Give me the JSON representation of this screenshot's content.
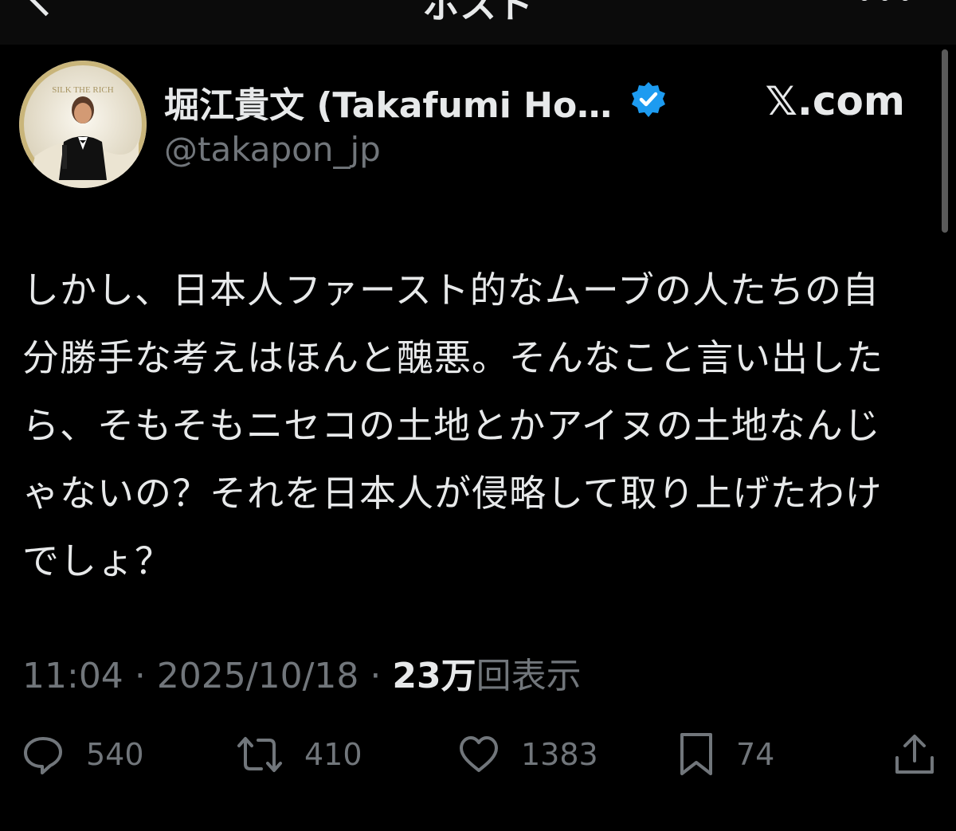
{
  "header": {
    "title": "ポスト"
  },
  "author": {
    "display_name": "堀江貴文 (Takafumi Ho…",
    "handle": "@takapon_jp",
    "verified_icon": "verified-badge-icon",
    "avatar_text": "SILK THE RICH"
  },
  "brand": "𝕏.com",
  "post": {
    "text": "しかし、日本人ファースト的なムーブの人たちの自分勝手な考えはほんと醜悪。そんなこと言い出したら、そもそもニセコの土地とかアイヌの土地なんじゃないの？それを日本人が侵略して取り上げたわけでしょ？",
    "time": "11:04",
    "date": "2025/10/18",
    "separator": "·",
    "views_count": "23万",
    "views_label": "回表示"
  },
  "actions": {
    "replies": "540",
    "reposts": "410",
    "likes": "1383",
    "bookmarks": "74"
  },
  "colors": {
    "background": "#000000",
    "text": "#e7e9ea",
    "muted": "#71767b",
    "verified": "#1d9bf0"
  }
}
